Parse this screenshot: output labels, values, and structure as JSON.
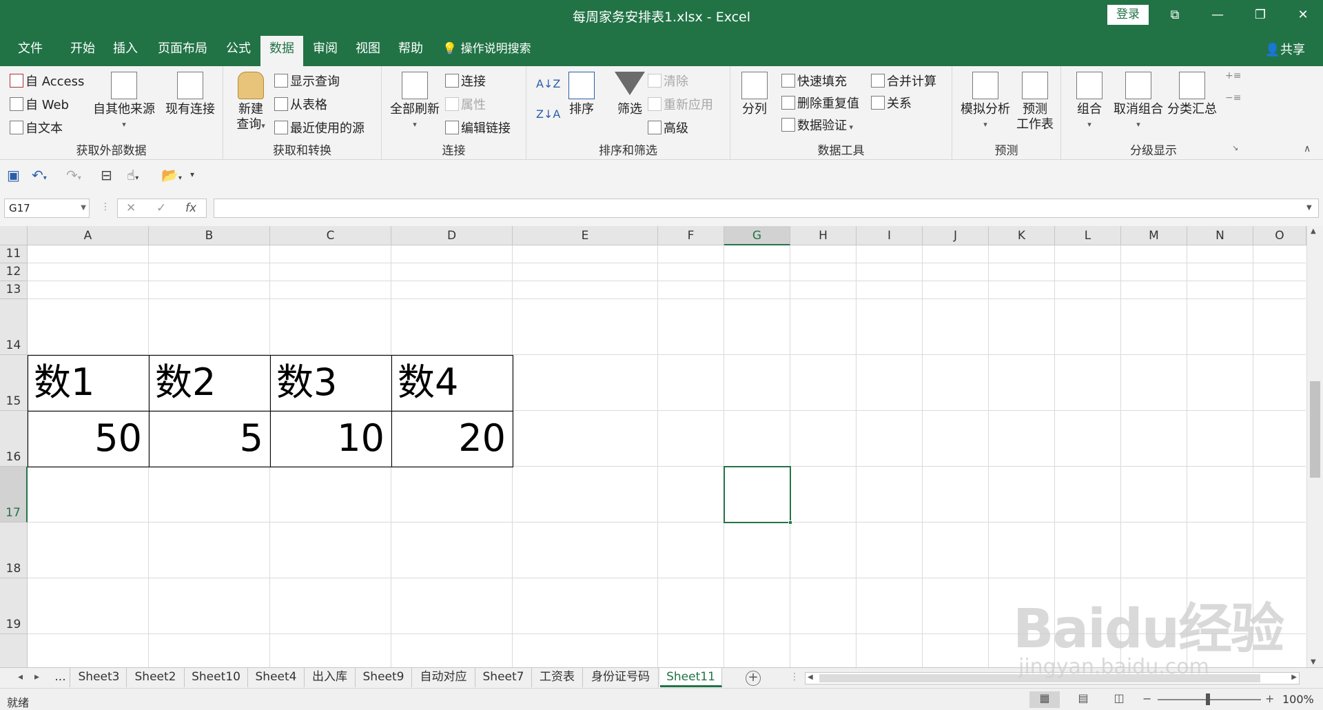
{
  "window": {
    "title": "每周家务安排表1.xlsx  -  Excel",
    "login_label": "登录",
    "share_label": "共享"
  },
  "tabs": [
    "文件",
    "开始",
    "插入",
    "页面布局",
    "公式",
    "数据",
    "审阅",
    "视图",
    "帮助"
  ],
  "active_tab": "数据",
  "tell_me": "操作说明搜索",
  "ribbon": {
    "get_external": {
      "label": "获取外部数据",
      "access": "自 Access",
      "web": "自 Web",
      "text": "自文本",
      "other_sources": "自其他来源",
      "existing": "现有连接"
    },
    "get_transform": {
      "label": "获取和转换",
      "new_query_1": "新建",
      "new_query_2": "查询",
      "show_queries": "显示查询",
      "from_table": "从表格",
      "recent_sources": "最近使用的源"
    },
    "connections": {
      "label": "连接",
      "refresh_all": "全部刷新",
      "connections": "连接",
      "properties": "属性",
      "edit_links": "编辑链接"
    },
    "sort_filter": {
      "label": "排序和筛选",
      "sort": "排序",
      "filter": "筛选",
      "clear": "清除",
      "reapply": "重新应用",
      "advanced": "高级"
    },
    "data_tools": {
      "label": "数据工具",
      "text_to_columns": "分列",
      "flash_fill": "快速填充",
      "remove_duplicates": "删除重复值",
      "data_validation": "数据验证",
      "consolidate": "合并计算",
      "relationships": "关系"
    },
    "forecast": {
      "label": "预测",
      "what_if": "模拟分析",
      "forecast_sheet_1": "预测",
      "forecast_sheet_2": "工作表"
    },
    "outline": {
      "label": "分级显示",
      "group": "组合",
      "ungroup": "取消组合",
      "subtotal": "分类汇总"
    }
  },
  "name_box": "G17",
  "fx_label": "fx",
  "columns": [
    "A",
    "B",
    "C",
    "D",
    "E",
    "F",
    "G",
    "H",
    "I",
    "J",
    "K",
    "L",
    "M",
    "N",
    "O"
  ],
  "rows": [
    "11",
    "12",
    "13",
    "14",
    "15",
    "16",
    "17",
    "18",
    "19"
  ],
  "cells": {
    "A15": "数1",
    "B15": "数2",
    "C15": "数3",
    "D15": "数4",
    "A16": "50",
    "B16": "5",
    "C16": "10",
    "D16": "20"
  },
  "sheets": [
    "...",
    "Sheet3",
    "Sheet2",
    "Sheet10",
    "Sheet4",
    "出入库",
    "Sheet9",
    "自动对应",
    "Sheet7",
    "工资表",
    "身份证号码",
    "Sheet11"
  ],
  "active_sheet": "Sheet11",
  "status": "就绪",
  "zoom": "100%",
  "watermark": "Baidu经验",
  "watermark_sub": "jingyan.baidu.com"
}
